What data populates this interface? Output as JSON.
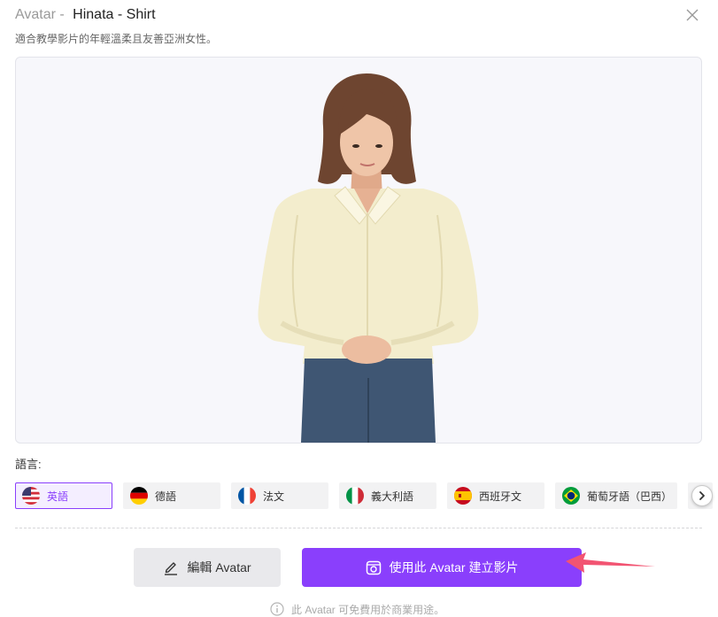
{
  "dialog": {
    "title_prefix": "Avatar - ",
    "title_name": "Hinata - Shirt",
    "description": "適合教學影片的年輕溫柔且友善亞洲女性。",
    "close_icon": "close-icon"
  },
  "language": {
    "label": "語言:",
    "options": [
      {
        "label": "英語",
        "flag_icon": "us-flag-icon",
        "selected": true
      },
      {
        "label": "德語",
        "flag_icon": "germany-flag-icon",
        "selected": false
      },
      {
        "label": "法文",
        "flag_icon": "france-flag-icon",
        "selected": false
      },
      {
        "label": "義大利語",
        "flag_icon": "italy-flag-icon",
        "selected": false
      },
      {
        "label": "西班牙文",
        "flag_icon": "spain-flag-icon",
        "selected": false
      },
      {
        "label": "葡萄牙語（巴西）",
        "flag_icon": "brazil-flag-icon",
        "selected": false
      }
    ],
    "next_icon": "chevron-right-icon"
  },
  "actions": {
    "edit": {
      "label": "編輯 Avatar",
      "icon": "pencil-icon"
    },
    "create": {
      "label": "使用此 Avatar 建立影片",
      "icon": "video-create-icon"
    }
  },
  "footer": {
    "note": "此 Avatar 可免費用於商業用途。",
    "icon": "info-icon"
  },
  "colors": {
    "accent": "#8a3ffc",
    "accent_light": "#f4eeff",
    "annotation_arrow": "#f25472"
  }
}
